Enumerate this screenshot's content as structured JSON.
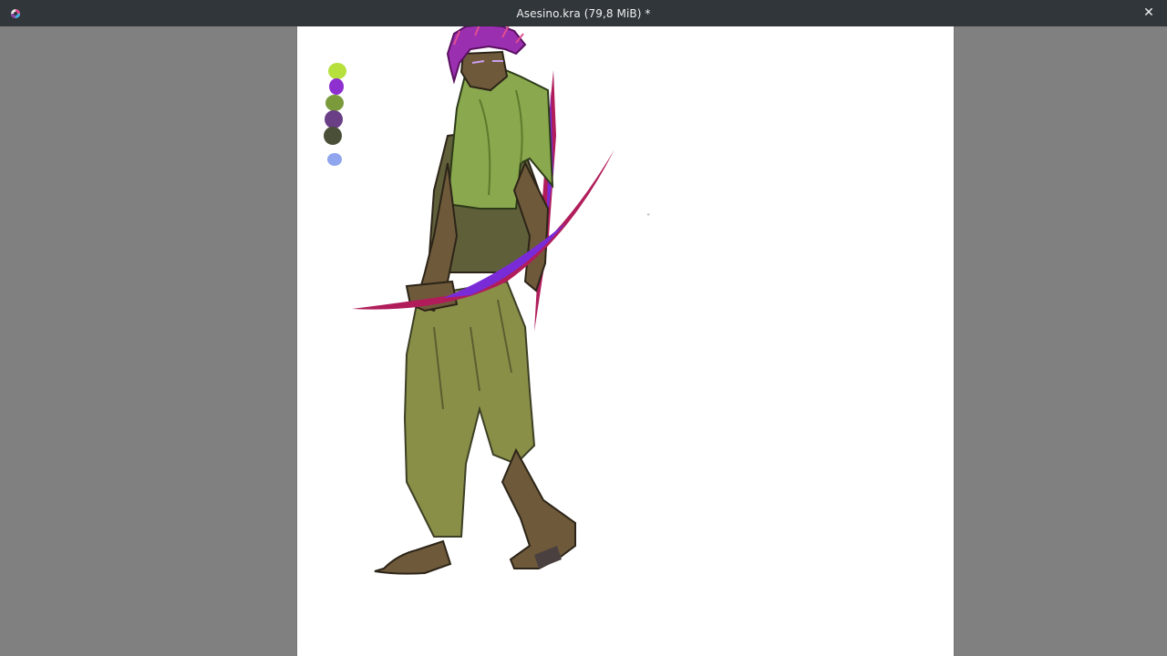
{
  "window": {
    "title": "Asesino.kra (79,8 MiB) *",
    "close_icon": "close-icon",
    "app_icon": "krita-app-icon"
  },
  "canvas": {
    "document_name": "Asesino.kra",
    "palette_swatches": [
      "#b6e03c",
      "#8e2fcf",
      "#7a9a3c",
      "#6a3f86",
      "#4a4f38",
      "#8fa5ee"
    ],
    "colors": {
      "hair": "#9a2fb0",
      "shirt": "#8aa84e",
      "skin": "#6e5a3a",
      "pants": "#8a8f48",
      "blade": "#b01d5a",
      "blade_glow": "#7a2bd8"
    }
  }
}
